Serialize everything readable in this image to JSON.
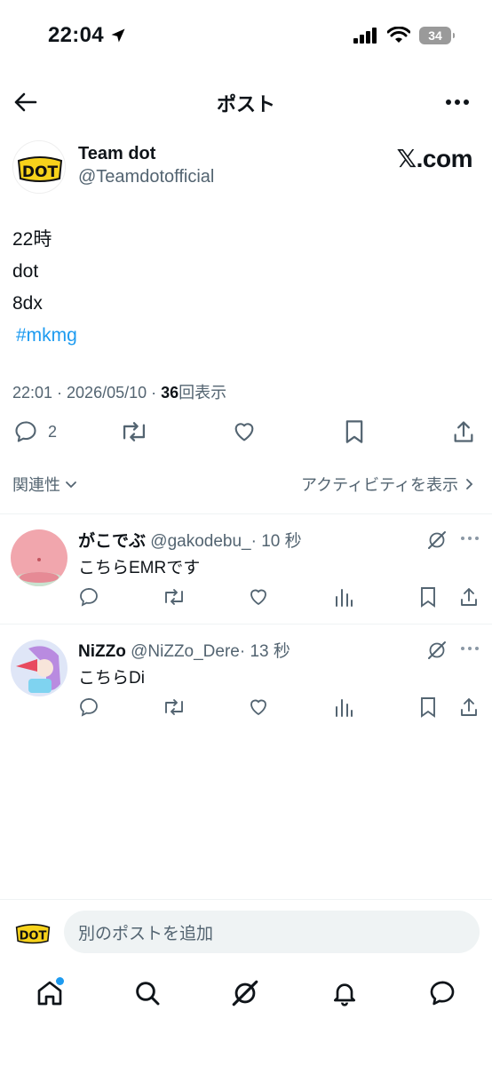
{
  "status_bar": {
    "time": "22:04",
    "battery": "34"
  },
  "header": {
    "title": "ポスト"
  },
  "author": {
    "name": "Team dot",
    "handle": "@Teamdotofficial",
    "brand": "𝕏.com",
    "avatar_text": "DOT"
  },
  "post": {
    "lines": [
      "22時",
      "dot",
      "8dx"
    ],
    "hashtag": "#mkmg",
    "time": "22:01 · 2026/05/10 · ",
    "views_count": "36",
    "views_label": "回表示",
    "reply_count": "2"
  },
  "sort": {
    "label": "関連性",
    "activity": "アクティビティを表示"
  },
  "replies": [
    {
      "name": "がこでぶ",
      "handle": "@gakodebu_",
      "time": "· 10 秒",
      "text": "こちらEMRです"
    },
    {
      "name": "NiZZo",
      "handle": "@NiZZo_Dere",
      "time": "· 13 秒",
      "text": "こちらDi"
    }
  ],
  "compose": {
    "placeholder": "別のポストを追加"
  },
  "colors": {
    "accent": "#1d9bf0",
    "text": "#0f1419",
    "muted": "#536471",
    "brand_yellow": "#f7d21b"
  }
}
